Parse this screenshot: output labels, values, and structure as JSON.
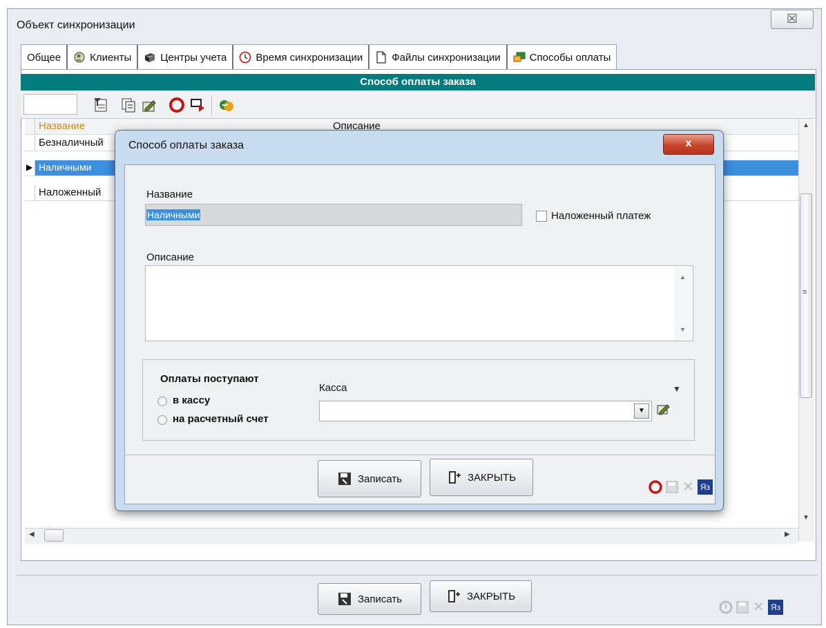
{
  "window": {
    "title": "Объект синхронизации",
    "close_glyph": "☒"
  },
  "tabs": [
    {
      "label": "Общее",
      "icon": ""
    },
    {
      "label": "Клиенты",
      "icon": "clients-icon"
    },
    {
      "label": "Центры учета",
      "icon": "book-icon"
    },
    {
      "label": "Время синхронизации",
      "icon": "clock-icon"
    },
    {
      "label": "Файлы синхронизации",
      "icon": "file-icon"
    },
    {
      "label": "Способы оплаты",
      "icon": "payment-icon"
    }
  ],
  "panel": {
    "header": "Способ оплаты заказа",
    "columns": {
      "name": "Название",
      "description": "Описание"
    },
    "rows": [
      {
        "name": "Безналичный"
      },
      {
        "name": "Наличными"
      },
      {
        "name": "Наложенный"
      }
    ],
    "selected_row": 1
  },
  "dialog": {
    "title": "Способ оплаты заказа",
    "close_glyph": "x",
    "name_label": "Название",
    "name_value": "Наличными",
    "cod_label": "Наложенный платеж",
    "description_label": "Описание",
    "description_value": "",
    "payments_label": "Оплаты поступают",
    "radio_cash": "в кассу",
    "radio_account": "на расчетный счет",
    "kassa_label": "Касса",
    "kassa_value": "",
    "save_button": "Записать",
    "close_button": "ЗАКРЫТЬ",
    "lang_badge": "Яз"
  },
  "footer": {
    "save_button": "Записать",
    "close_button": "ЗАКРЫТЬ",
    "lang_badge": "Яз"
  },
  "colors": {
    "header_teal": "#047b7d",
    "selection_blue": "#3d8fe0",
    "column_header_orange": "#d58a17",
    "refresh_red": "#c41616"
  }
}
